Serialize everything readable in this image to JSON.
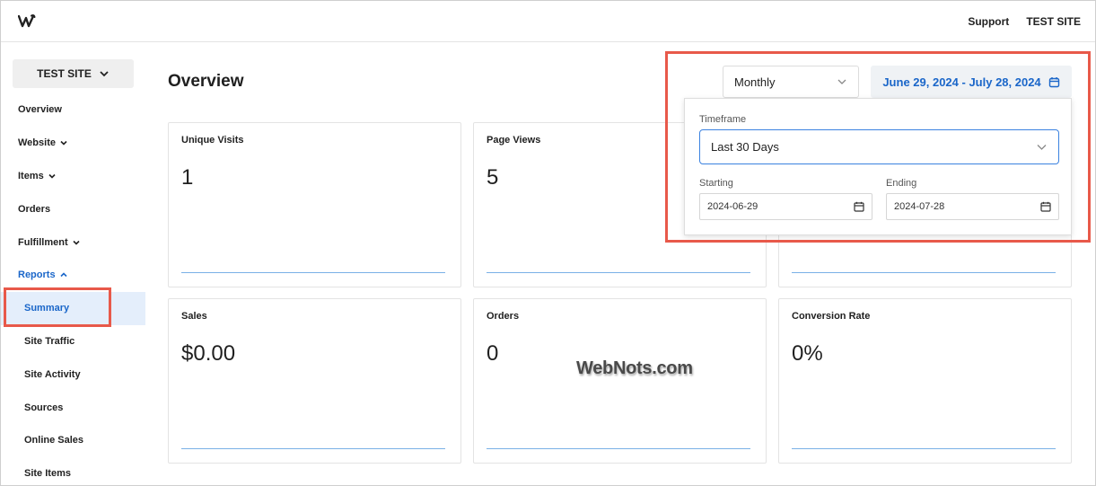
{
  "topbar": {
    "logo_icon": "weebly-w-icon",
    "links": [
      "Support",
      "TEST SITE"
    ]
  },
  "sidebar": {
    "site_button": "TEST SITE",
    "items": [
      {
        "label": "Overview"
      },
      {
        "label": "Website"
      },
      {
        "label": "Items"
      },
      {
        "label": "Orders"
      },
      {
        "label": "Fulfillment"
      },
      {
        "label": "Reports"
      },
      {
        "label": "Summary"
      },
      {
        "label": "Site Traffic"
      },
      {
        "label": "Site Activity"
      },
      {
        "label": "Sources"
      },
      {
        "label": "Online Sales"
      },
      {
        "label": "Site Items"
      }
    ]
  },
  "main": {
    "title": "Overview",
    "period_select": "Monthly",
    "date_range": "June 29, 2024 - July 28, 2024",
    "cards": [
      {
        "label": "Unique Visits",
        "value": "1"
      },
      {
        "label": "Page Views",
        "value": "5"
      },
      {
        "label": "Sales",
        "value": "$0.00"
      },
      {
        "label": "Orders",
        "value": "0"
      },
      {
        "label": "Conversion Rate",
        "value": "0%"
      }
    ]
  },
  "panel": {
    "timeframe_label": "Timeframe",
    "timeframe_value": "Last 30 Days",
    "starting_label": "Starting",
    "starting_value": "2024-06-29",
    "ending_label": "Ending",
    "ending_value": "2024-07-28"
  },
  "watermark": "WebNots.com",
  "colors": {
    "accent": "#1a66c9",
    "highlight": "#e8594a",
    "chart_line": "#7ab1e6"
  }
}
